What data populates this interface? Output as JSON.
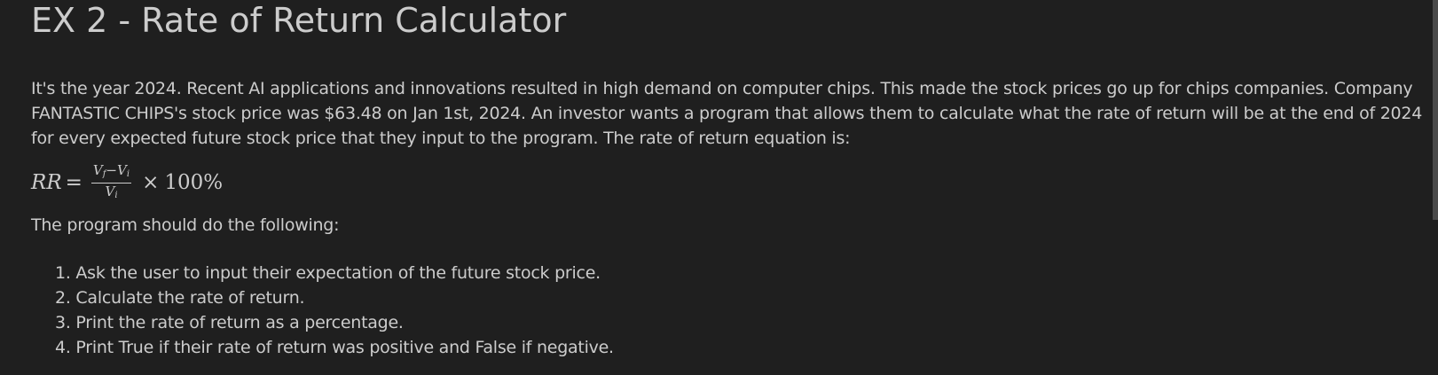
{
  "cell": {
    "title": "EX 2 - Rate of Return Calculator",
    "intro": "It's the year 2024. Recent AI applications and innovations resulted in high demand on computer chips. This made the stock prices go up for chips companies. Company FANTASTIC CHIPS's stock price was $63.48 on Jan 1st, 2024. An investor wants a program that allows them to calculate what the rate of return will be at the end of 2024 for every expected future stock price that they input to the program. The rate of return equation is:",
    "equation": {
      "lhs": "RR",
      "equals": "=",
      "numerator_a": "V",
      "numerator_a_sub": "f",
      "minus": "−",
      "numerator_b": "V",
      "numerator_b_sub": "i",
      "denominator": "V",
      "denominator_sub": "i",
      "times": "×",
      "factor": "100%"
    },
    "steps_lead": "The program should do the following:",
    "steps": [
      "1. Ask the user to input their expectation of the future stock price.",
      "2. Calculate the rate of return.",
      "3. Print the rate of return as a percentage.",
      "4. Print True if their rate of return was positive and False if negative."
    ]
  },
  "colors": {
    "background": "#1f1f1f",
    "text": "#cccccc",
    "scrollbar_thumb": "#4a4a4a"
  }
}
